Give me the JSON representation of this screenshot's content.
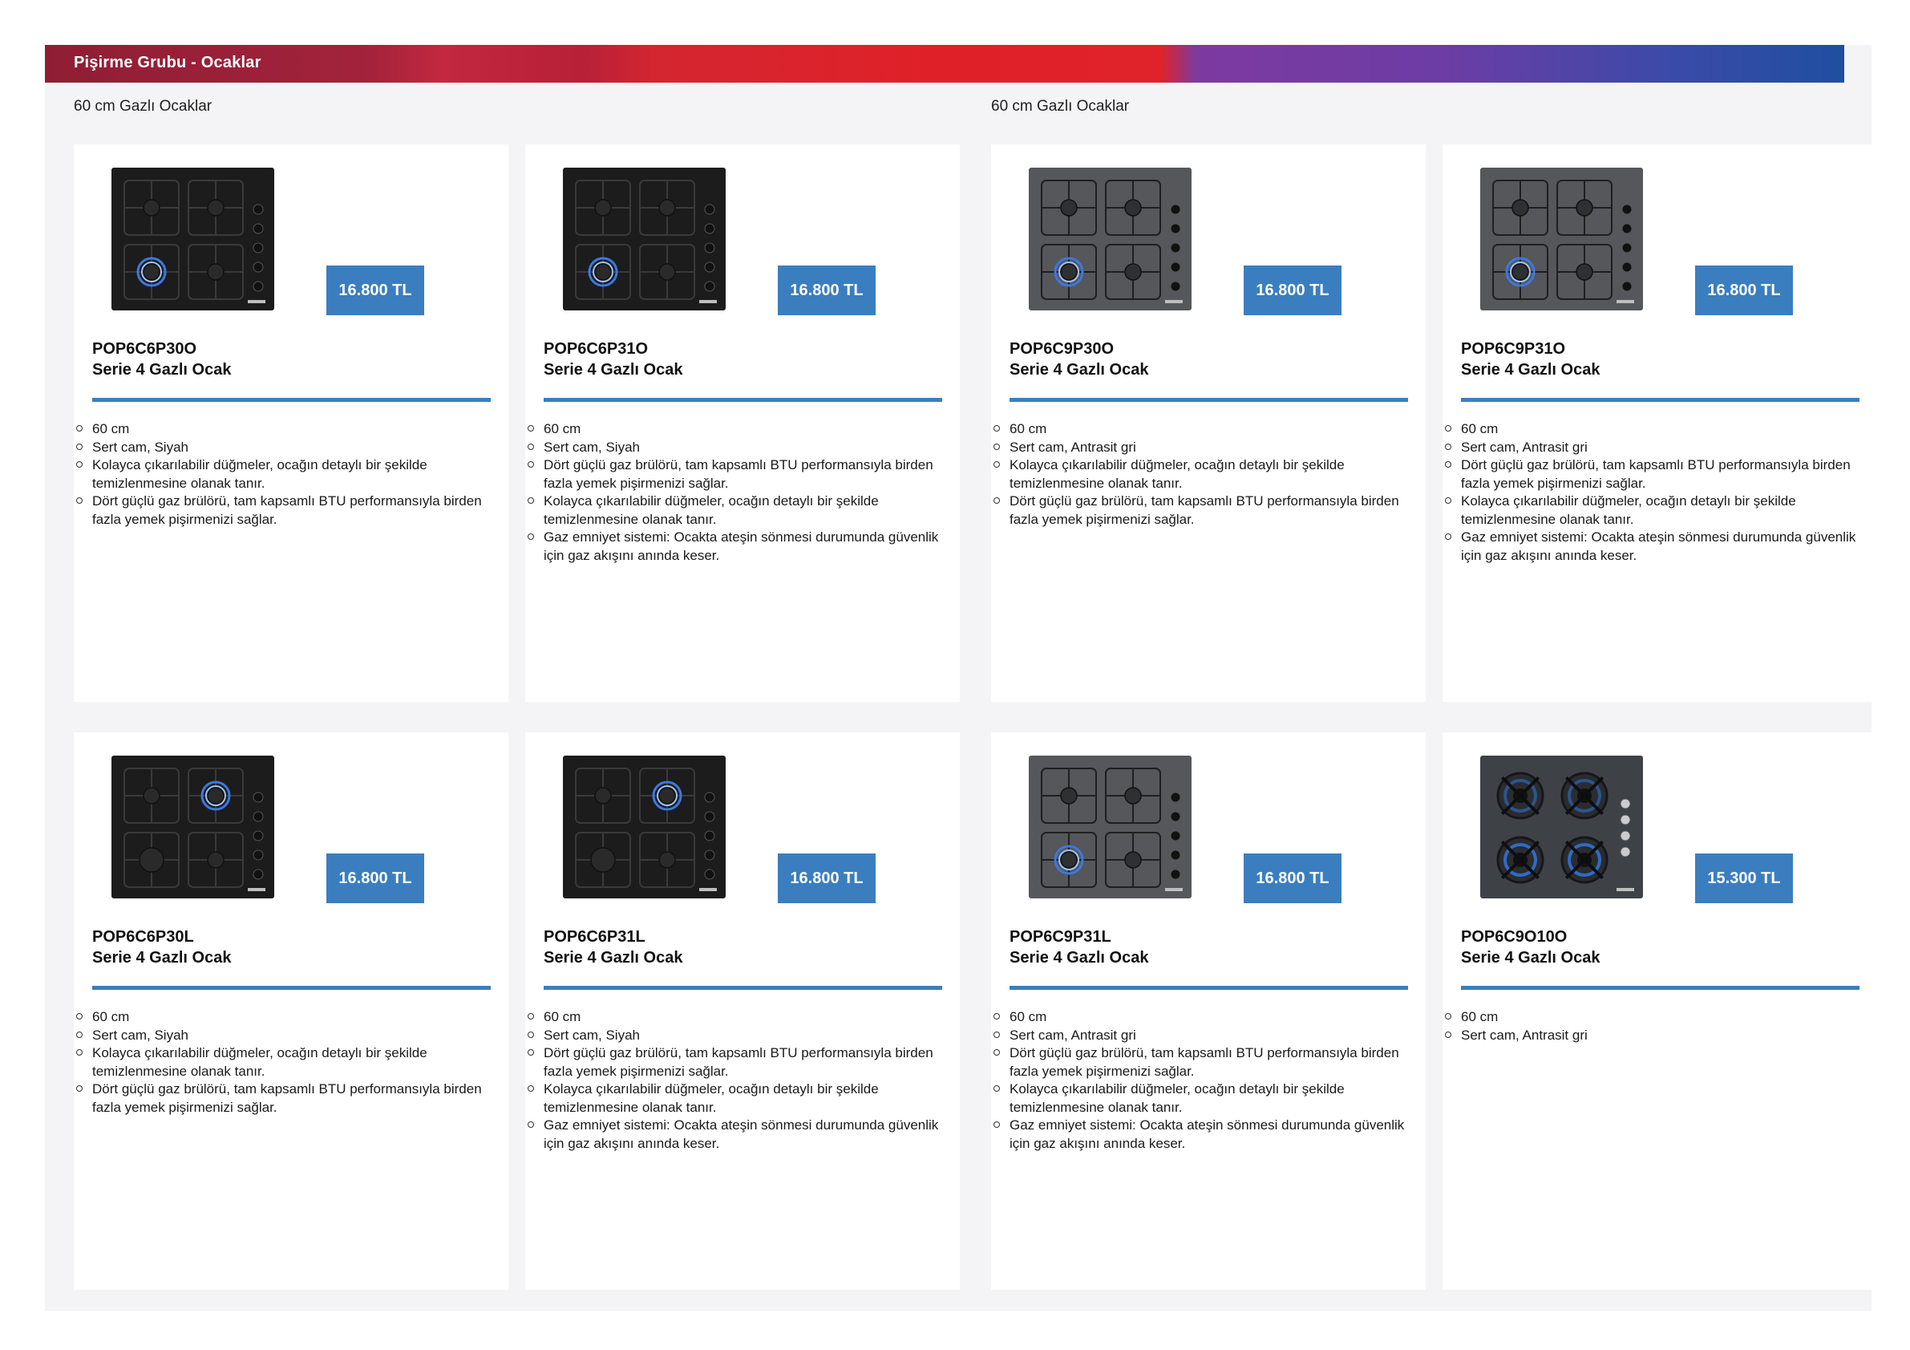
{
  "header": {
    "title": "Pişirme Grubu - Ocaklar"
  },
  "sections": [
    {
      "title": "60 cm Gazlı Ocaklar"
    },
    {
      "title": "60 cm Gazlı Ocaklar"
    }
  ],
  "colors": {
    "price_bg": "#3a7ec0",
    "rule": "#3a7ec0",
    "page_bg": "#f4f4f6"
  },
  "products": [
    {
      "model": "POP6C6P30O",
      "subtitle": "Serie 4 Gazlı Ocak",
      "price": "16.800 TL",
      "finish": "black",
      "features": [
        "60 cm",
        "Sert cam, Siyah",
        "Kolayca çıkarılabilir düğmeler, ocağın detaylı bir şekilde temizlenmesine olanak tanır.",
        "Dört güçlü gaz brülörü, tam kapsamlı BTU performansıyla birden fazla yemek pişirmenizi sağlar."
      ]
    },
    {
      "model": "POP6C6P31O",
      "subtitle": "Serie 4 Gazlı Ocak",
      "price": "16.800 TL",
      "finish": "black",
      "features": [
        "60 cm",
        "Sert cam, Siyah",
        "Dört güçlü gaz brülörü, tam kapsamlı BTU performansıyla birden fazla yemek pişirmenizi sağlar.",
        "Kolayca çıkarılabilir düğmeler, ocağın detaylı bir şekilde temizlenmesine olanak tanır.",
        "Gaz emniyet sistemi: Ocakta ateşin sönmesi durumunda güvenlik için gaz akışını anında keser."
      ]
    },
    {
      "model": "POP6C9P30O",
      "subtitle": "Serie 4 Gazlı Ocak",
      "price": "16.800 TL",
      "finish": "anthracite",
      "features": [
        "60 cm",
        "Sert cam, Antrasit gri",
        "Kolayca çıkarılabilir düğmeler, ocağın detaylı bir şekilde temizlenmesine olanak tanır.",
        "Dört güçlü gaz brülörü, tam kapsamlı BTU performansıyla birden fazla yemek pişirmenizi sağlar."
      ]
    },
    {
      "model": "POP6C9P31O",
      "subtitle": "Serie 4 Gazlı Ocak",
      "price": "16.800 TL",
      "finish": "anthracite",
      "features": [
        "60 cm",
        "Sert cam, Antrasit gri",
        "Dört güçlü gaz brülörü, tam kapsamlı BTU performansıyla birden fazla yemek pişirmenizi sağlar.",
        "Kolayca çıkarılabilir düğmeler, ocağın detaylı bir şekilde temizlenmesine olanak tanır.",
        "Gaz emniyet sistemi: Ocakta ateşin sönmesi durumunda güvenlik için gaz akışını anında keser."
      ]
    },
    {
      "model": "POP6C6P30L",
      "subtitle": "Serie 4 Gazlı Ocak",
      "price": "16.800 TL",
      "finish": "black-l",
      "features": [
        "60 cm",
        "Sert cam, Siyah",
        "Kolayca çıkarılabilir düğmeler, ocağın detaylı bir şekilde temizlenmesine olanak tanır.",
        "Dört güçlü gaz brülörü, tam kapsamlı BTU performansıyla birden fazla yemek pişirmenizi sağlar."
      ]
    },
    {
      "model": "POP6C6P31L",
      "subtitle": "Serie 4 Gazlı Ocak",
      "price": "16.800 TL",
      "finish": "black-l",
      "features": [
        "60 cm",
        "Sert cam, Siyah",
        "Dört güçlü gaz brülörü, tam kapsamlı BTU performansıyla birden fazla yemek pişirmenizi sağlar.",
        "Kolayca çıkarılabilir düğmeler, ocağın detaylı bir şekilde temizlenmesine olanak tanır.",
        "Gaz emniyet sistemi: Ocakta ateşin sönmesi durumunda güvenlik için gaz akışını anında keser."
      ]
    },
    {
      "model": "POP6C9P31L",
      "subtitle": "Serie 4 Gazlı Ocak",
      "price": "16.800 TL",
      "finish": "anthracite",
      "features": [
        "60 cm",
        "Sert cam, Antrasit gri",
        "Dört güçlü gaz brülörü, tam kapsamlı BTU performansıyla birden fazla yemek pişirmenizi sağlar.",
        "Kolayca çıkarılabilir düğmeler, ocağın detaylı bir şekilde temizlenmesine olanak tanır.",
        "Gaz emniyet sistemi: Ocakta ateşin sönmesi durumunda güvenlik için gaz akışını anında keser."
      ]
    },
    {
      "model": "POP6C9O10O",
      "subtitle": "Serie 4 Gazlı Ocak",
      "price": "15.300 TL",
      "finish": "anthracite-cast",
      "features": [
        "60 cm",
        "Sert cam, Antrasit gri"
      ]
    }
  ]
}
